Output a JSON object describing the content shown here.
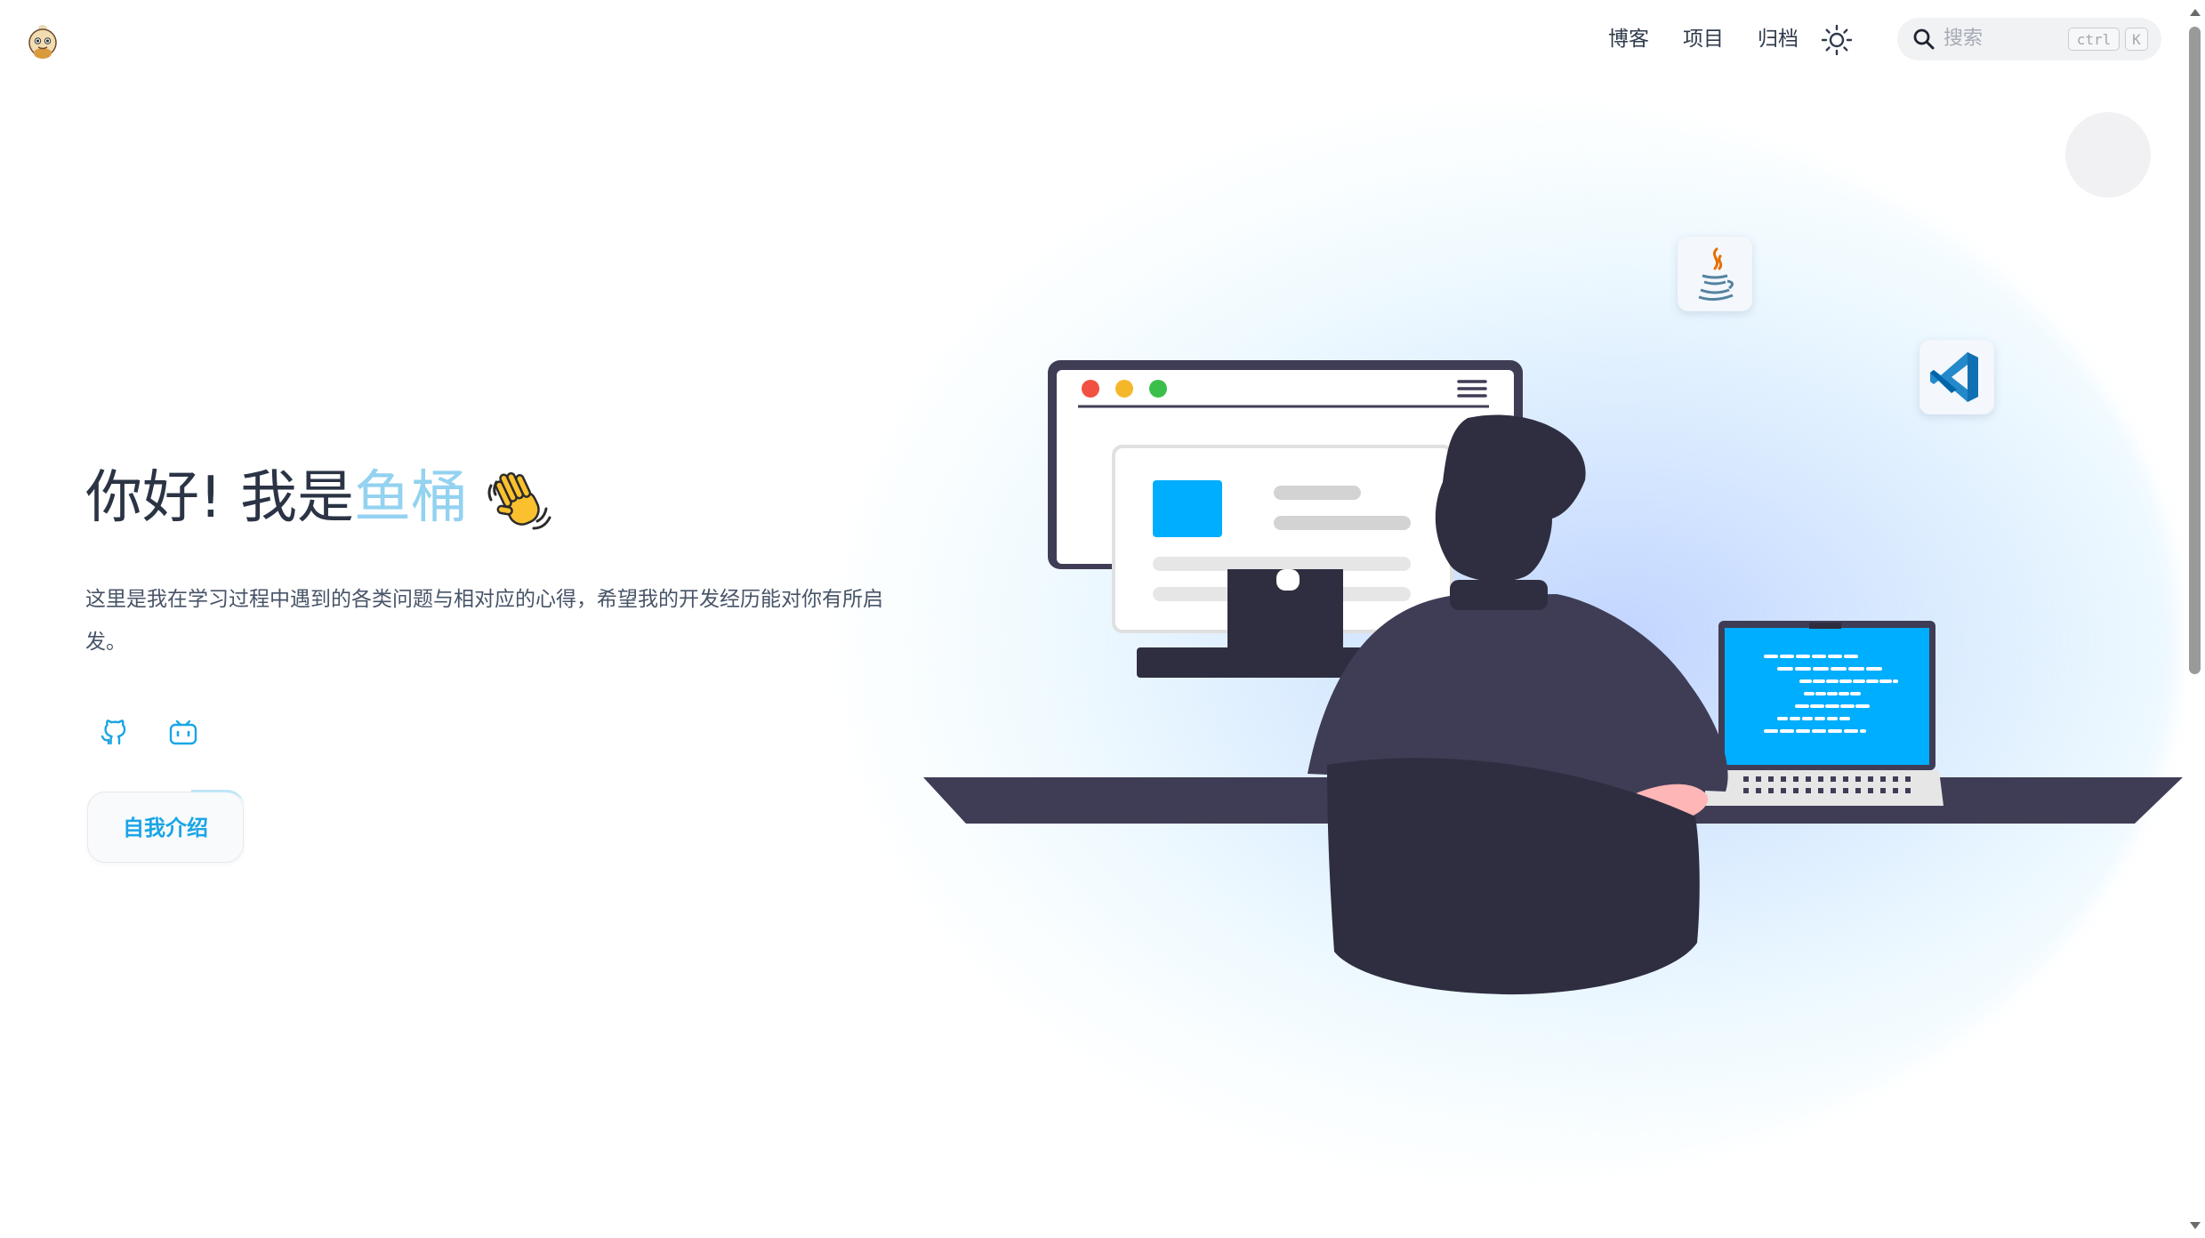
{
  "nav": {
    "links": [
      "博客",
      "项目",
      "归档"
    ],
    "theme_icon": "sun-icon",
    "logo_icon": "mascot-logo-icon"
  },
  "search": {
    "placeholder": "搜索",
    "shortcut_ctrl": "ctrl",
    "shortcut_key": "K",
    "icon": "search-icon"
  },
  "hero": {
    "greeting": "你好! 我是",
    "name": "鱼桶",
    "wave_icon": "waving-hand-icon",
    "description": "这里是我在学习过程中遇到的各类问题与相对应的心得，希望我的开发经历能对你有所启发。",
    "social_icons": [
      "github-icon",
      "bilibili-icon"
    ],
    "button_label": "自我介绍"
  },
  "illustration": {
    "tech_icons": [
      "java-icon",
      "vscode-icon"
    ]
  },
  "colors": {
    "accent": "#1aa5e6",
    "name_highlight": "#93d2f0",
    "illustration_dark": "#2f2e41",
    "illustration_blue": "#00aeff"
  }
}
